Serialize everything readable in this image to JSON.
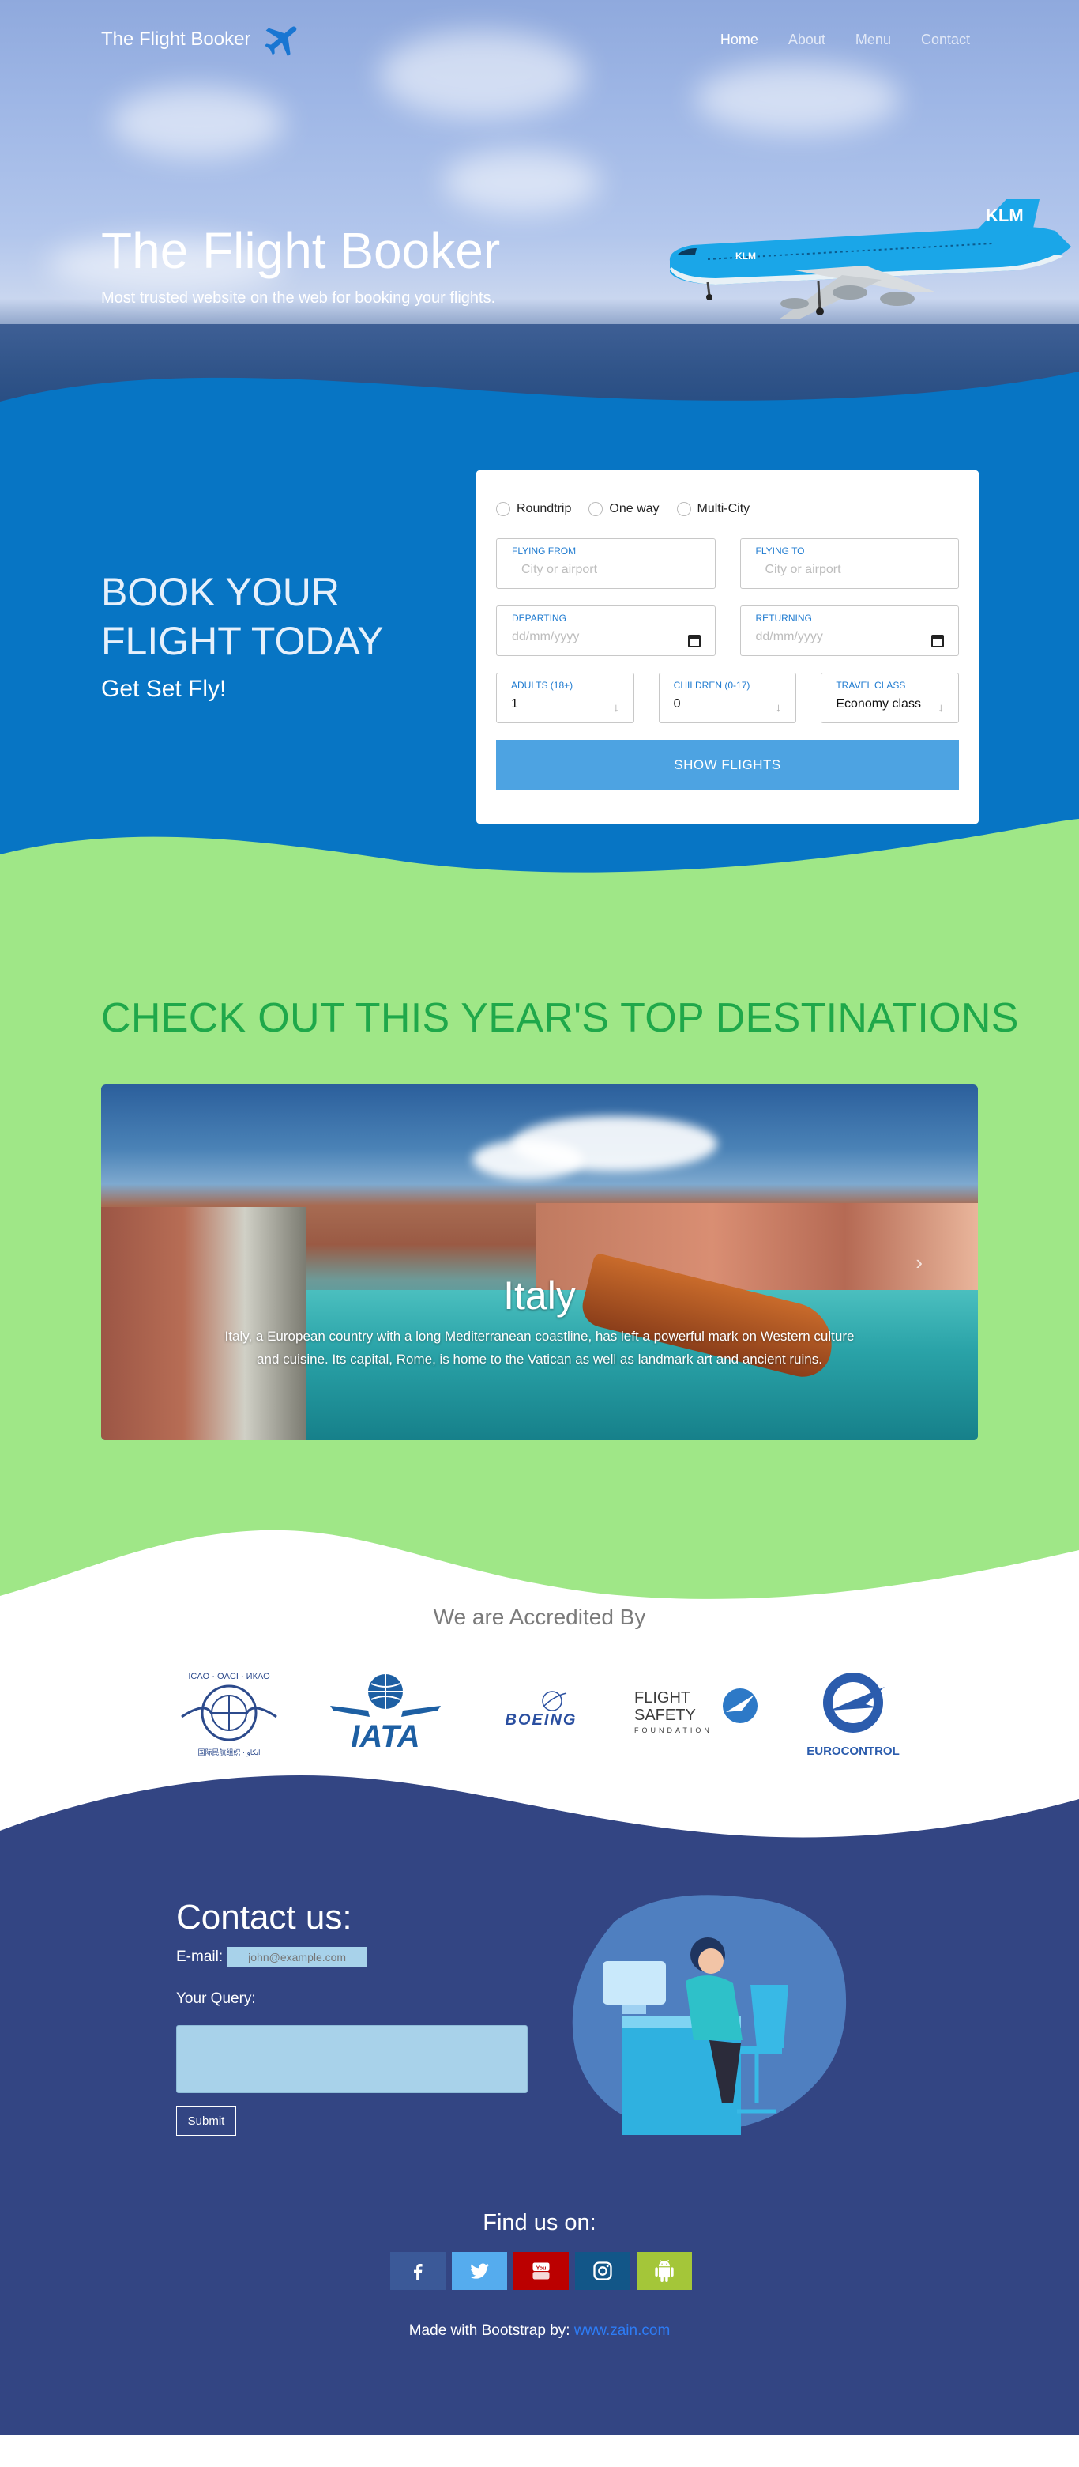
{
  "nav": {
    "brand": "The Flight Booker",
    "links": [
      "Home",
      "About",
      "Menu",
      "Contact"
    ],
    "active": "Home"
  },
  "hero": {
    "title": "The Flight Booker",
    "subtitle": "Most trusted website on the web for booking your flights."
  },
  "booking": {
    "title_line1": "BOOK YOUR",
    "title_line2": "FLIGHT TODAY",
    "subtitle": "Get Set Fly!",
    "trip_types": [
      "Roundtrip",
      "One way",
      "Multi-City"
    ],
    "flying_from": {
      "label": "FLYING FROM",
      "placeholder": "City or airport"
    },
    "flying_to": {
      "label": "FLYING TO",
      "placeholder": "City or airport"
    },
    "departing": {
      "label": "DEPARTING",
      "placeholder": "dd/mm/yyyy"
    },
    "returning": {
      "label": "RETURNING",
      "placeholder": "dd/mm/yyyy"
    },
    "adults": {
      "label": "ADULTS (18+)",
      "value": "1"
    },
    "children": {
      "label": "CHILDREN (0-17)",
      "value": "0"
    },
    "travel_class": {
      "label": "TRAVEL CLASS",
      "value": "Economy class"
    },
    "submit": "SHOW FLIGHTS"
  },
  "destinations": {
    "title": "CHECK OUT THIS YEAR'S TOP DESTINATIONS",
    "slide": {
      "name": "Italy",
      "description": "Italy, a European country with a long Mediterranean coastline, has left a powerful mark on Western culture and cuisine. Its capital, Rome, is home to the Vatican as well as landmark art and ancient ruins."
    },
    "next_icon": "chevron-right-icon"
  },
  "accreditation": {
    "heading": "We are Accredited By",
    "logos": [
      {
        "name": "ICAO",
        "text": "ICAO · OACI · ИКАО"
      },
      {
        "name": "IATA",
        "text": "IATA"
      },
      {
        "name": "BOEING",
        "text": "BOEING"
      },
      {
        "name": "Flight Safety Foundation",
        "text": "FLIGHT SAFETY FOUNDATION"
      },
      {
        "name": "EUROCONTROL",
        "text": "EUROCONTROL"
      }
    ]
  },
  "contact": {
    "title": "Contact us:",
    "email_label": "E-mail:",
    "email_placeholder": "john@example.com",
    "query_label": "Your Query:",
    "submit": "Submit",
    "find_us": "Find us on:",
    "socials": [
      {
        "icon": "facebook-icon",
        "color": "#3b5998"
      },
      {
        "icon": "twitter-icon",
        "color": "#55acee"
      },
      {
        "icon": "youtube-icon",
        "color": "#bb0000"
      },
      {
        "icon": "instagram-icon",
        "color": "#125688"
      },
      {
        "icon": "android-icon",
        "color": "#a4c639"
      }
    ],
    "made_by_text": "Made with Bootstrap by:",
    "made_by_link": "www.zain.com"
  },
  "colors": {
    "booking_bg": "#0775c4",
    "destinations_bg": "#9fe787",
    "contact_bg": "#334583",
    "title_green": "#1fa84a",
    "button_blue": "#4da3e2"
  }
}
